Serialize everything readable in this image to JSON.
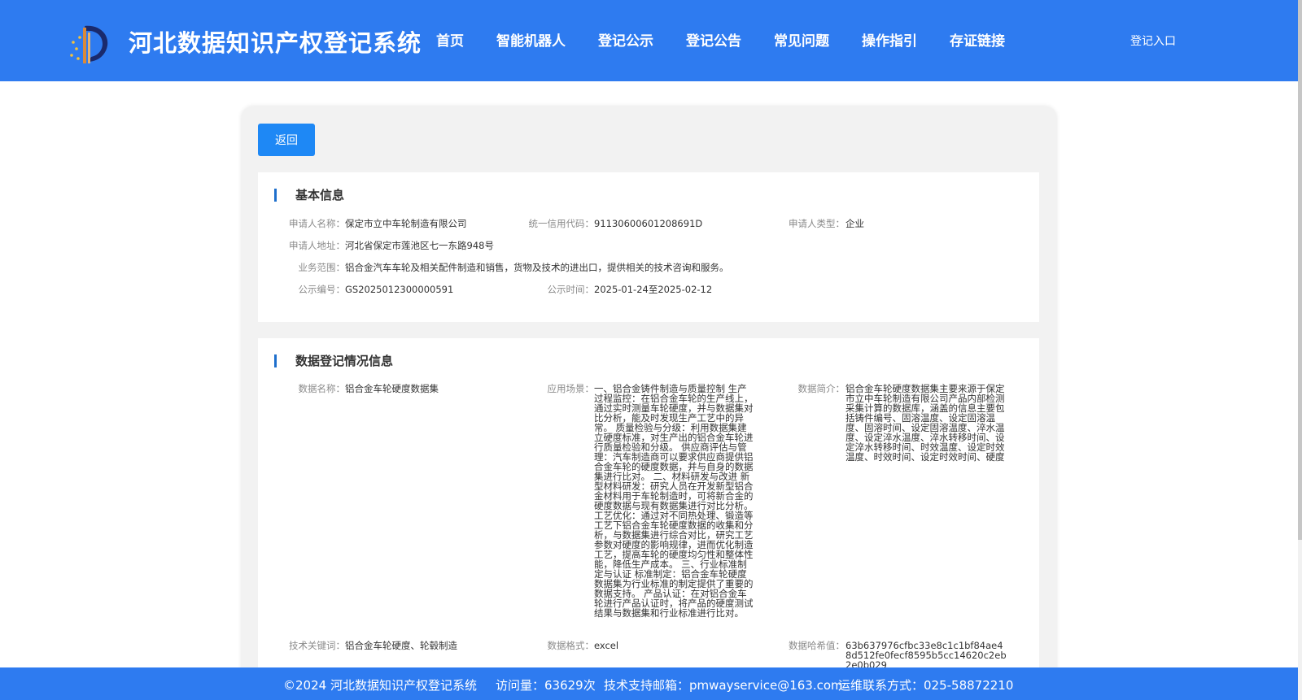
{
  "header": {
    "title": "河北数据知识产权登记系统",
    "nav": [
      "首页",
      "智能机器人",
      "登记公示",
      "登记公告",
      "常见问题",
      "操作指引",
      "存证链接"
    ],
    "login": "登记入口"
  },
  "back_label": "返回",
  "basic": {
    "title": "基本信息",
    "applicant_name": {
      "label": "申请人名称：",
      "value": "保定市立中车轮制造有限公司"
    },
    "credit_code": {
      "label": "统一信用代码：",
      "value": "91130600601208691D"
    },
    "applicant_type": {
      "label": "申请人类型：",
      "value": "企业"
    },
    "address": {
      "label": "申请人地址：",
      "value": "河北省保定市莲池区七一东路948号"
    },
    "scope": {
      "label": "业务范围：",
      "value": "铝合金汽车车轮及相关配件制造和销售，货物及技术的进出口，提供相关的技术咨询和服务。"
    },
    "notice_no": {
      "label": "公示编号：",
      "value": "GS2025012300000591"
    },
    "notice_time": {
      "label": "公示时间：",
      "value": "2025-01-24至2025-02-12"
    }
  },
  "registration": {
    "title": "数据登记情况信息",
    "data_name": {
      "label": "数据名称：",
      "value": "铝合金车轮硬度数据集"
    },
    "scenario": {
      "label": "应用场景：",
      "value": "一、铝合金铸件制造与质量控制 生产过程监控：在铝合金车轮的生产线上，通过实时测量车轮硬度，并与数据集对比分析，能及时发现生产工艺中的异常。 质量检验与分级：利用数据集建立硬度标准，对生产出的铝合金车轮进行质量检验和分级。 供应商评估与管理：汽车制造商可以要求供应商提供铝合金车轮的硬度数据，并与自身的数据集进行比对。 二、材料研发与改进 新型材料研发：研究人员在开发新型铝合金材料用于车轮制造时，可将新合金的硬度数据与现有数据集进行对比分析。 工艺优化：通过对不同热处理、锻造等工艺下铝合金车轮硬度数据的收集和分析，与数据集进行综合对比，研究工艺参数对硬度的影响规律，进而优化制造工艺，提高车轮的硬度均匀性和整体性能，降低生产成本。 三、行业标准制定与认证 标准制定：铝合金车轮硬度数据集为行业标准的制定提供了重要的数据支持。 产品认证：在对铝合金车轮进行产品认证时，将产品的硬度测试结果与数据集和行业标准进行比对。"
    },
    "intro": {
      "label": "数据简介：",
      "value": "铝合金车轮硬度数据集主要来源于保定市立中车轮制造有限公司产品内部检测采集计算的数据库，涵盖的信息主要包括铸件编号、固溶温度、设定固溶温度、固溶时间、设定固溶温度、淬水温度、设定淬水温度、淬水转移时间、设定淬水转移时间、时效温度、设定时效温度、时效时间、设定时效时间、硬度"
    },
    "keywords": {
      "label": "技术关键词：",
      "value": "铝合金车轮硬度、轮毂制造"
    },
    "format": {
      "label": "数据格式：",
      "value": "excel"
    },
    "hash": {
      "label": "数据哈希值：",
      "value": "63b637976cfbc33e8c1c1bf84ae48d512fe0fecf8595b5cc14620c2eb2e0b029"
    }
  },
  "footer": {
    "copyright": "©2024 河北数据知识产权登记系统",
    "visits": "访问量：63629次",
    "email": "技术支持邮箱：pmwayservice@163.com",
    "phone": "运维联系方式：025-58872210"
  },
  "colors": {
    "brand": "#2e7bf0",
    "button": "#1e88f5",
    "accent_bar": "#1e6fcc"
  }
}
